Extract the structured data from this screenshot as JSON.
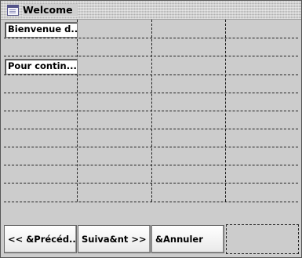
{
  "window": {
    "title": "Welcome"
  },
  "fields": {
    "welcome_text": "Bienvenue d...",
    "continue_text": "Pour contin..."
  },
  "buttons": {
    "previous": "<< &Précéd...",
    "next": "Suiva&nt >>",
    "cancel": "&Annuler"
  },
  "colors": {
    "background": "#cccccc",
    "field_background": "#ffffff",
    "title_icon": "#54548a"
  },
  "icons": {
    "title": "window-icon"
  }
}
